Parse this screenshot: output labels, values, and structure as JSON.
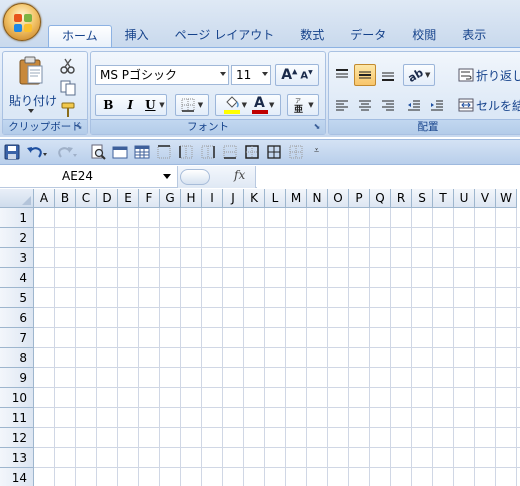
{
  "ribbon_tabs": [
    {
      "label": "ホーム",
      "active": true
    },
    {
      "label": "挿入",
      "active": false
    },
    {
      "label": "ページ レイアウト",
      "active": false
    },
    {
      "label": "数式",
      "active": false
    },
    {
      "label": "データ",
      "active": false
    },
    {
      "label": "校閲",
      "active": false
    },
    {
      "label": "表示",
      "active": false
    }
  ],
  "clipboard": {
    "paste_label": "貼り付け",
    "group_label": "クリップボード"
  },
  "font": {
    "font_name": "MS Pゴシック",
    "font_size": "11",
    "bold_label": "B",
    "italic_label": "I",
    "underline_label": "U",
    "font_color_label": "A",
    "grow_label": "A",
    "shrink_label": "A",
    "group_label": "フォント",
    "highlight_color": "#ffff00",
    "font_color": "#c00000"
  },
  "alignment": {
    "wrap_text_label": "折り返し",
    "merge_label": "セルを結",
    "group_label": "配置"
  },
  "name_box": {
    "value": "AE24"
  },
  "formula_bar": {
    "fx_label": "fx",
    "value": ""
  },
  "sheet": {
    "columns": [
      "A",
      "B",
      "C",
      "D",
      "E",
      "F",
      "G",
      "H",
      "I",
      "J",
      "K",
      "L",
      "M",
      "N",
      "O",
      "P",
      "Q",
      "R",
      "S",
      "T",
      "U",
      "V",
      "W"
    ],
    "rows": [
      "1",
      "2",
      "3",
      "4",
      "5",
      "6",
      "7",
      "8",
      "9",
      "10",
      "11",
      "12",
      "13",
      "14"
    ]
  },
  "icons": {
    "quick_access": [
      "save-icon",
      "undo-icon",
      "redo-icon",
      "print-preview-icon",
      "border-icon",
      "table-icon",
      "grid-icon"
    ]
  }
}
